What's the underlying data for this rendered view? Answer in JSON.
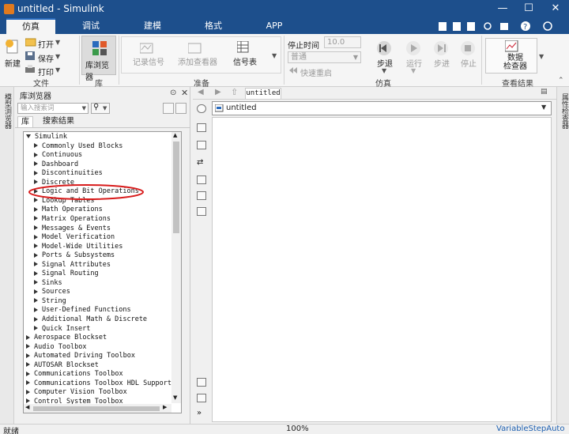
{
  "window": {
    "title": "untitled - Simulink",
    "minimize_label": "—",
    "maximize_label": "☐",
    "close_label": "✕"
  },
  "ribbon_tabs": [
    {
      "label": "仿真",
      "active": true
    },
    {
      "label": "调试",
      "active": false
    },
    {
      "label": "建模",
      "active": false
    },
    {
      "label": "格式",
      "active": false
    },
    {
      "label": "APP",
      "active": false
    }
  ],
  "ribbon": {
    "file": {
      "new_label": "新建",
      "open_label": "打开",
      "save_label": "保存",
      "print_label": "打印",
      "group_label": "文件"
    },
    "library": {
      "browser_label": "库浏览器",
      "group_label": "库"
    },
    "prepare": {
      "log_signals_label": "记录信号",
      "add_viewer_label": "添加查看器",
      "signal_table_label": "信号表",
      "group_label": "准备"
    },
    "simulate": {
      "stop_time_label": "停止时间",
      "stop_time_value": "10.0",
      "mode_value": "普通",
      "fast_restart_label": "快速重启",
      "step_back_label": "步退",
      "run_label": "运行",
      "step_forward_label": "步进",
      "stop_label": "停止",
      "group_label": "仿真"
    },
    "review": {
      "data_inspector_label": "数据\n检查器",
      "group_label": "查看结果"
    }
  },
  "left_strip": {
    "model_browser_label": "模型浏览器"
  },
  "right_strip": {
    "property_inspector_label": "属性检查器"
  },
  "library_browser": {
    "title": "库浏览器",
    "search_placeholder": "输入搜索词",
    "tabs": [
      "库",
      "搜索结果"
    ],
    "tree": [
      {
        "label": "Simulink",
        "expanded": true,
        "level": 0
      },
      {
        "label": "Commonly Used Blocks",
        "level": 1
      },
      {
        "label": "Continuous",
        "level": 1
      },
      {
        "label": "Dashboard",
        "level": 1
      },
      {
        "label": "Discontinuities",
        "level": 1
      },
      {
        "label": "Discrete",
        "level": 1
      },
      {
        "label": "Logic and Bit Operations",
        "level": 1,
        "highlighted": true
      },
      {
        "label": "Lookup Tables",
        "level": 1
      },
      {
        "label": "Math Operations",
        "level": 1
      },
      {
        "label": "Matrix Operations",
        "level": 1
      },
      {
        "label": "Messages & Events",
        "level": 1
      },
      {
        "label": "Model Verification",
        "level": 1
      },
      {
        "label": "Model-Wide Utilities",
        "level": 1
      },
      {
        "label": "Ports & Subsystems",
        "level": 1
      },
      {
        "label": "Signal Attributes",
        "level": 1
      },
      {
        "label": "Signal Routing",
        "level": 1
      },
      {
        "label": "Sinks",
        "level": 1
      },
      {
        "label": "Sources",
        "level": 1
      },
      {
        "label": "String",
        "level": 1
      },
      {
        "label": "User-Defined Functions",
        "level": 1
      },
      {
        "label": "Additional Math & Discrete",
        "level": 1
      },
      {
        "label": "Quick Insert",
        "level": 1
      },
      {
        "label": "Aerospace Blockset",
        "level": 0
      },
      {
        "label": "Audio Toolbox",
        "level": 0
      },
      {
        "label": "Automated Driving Toolbox",
        "level": 0
      },
      {
        "label": "AUTOSAR Blockset",
        "level": 0
      },
      {
        "label": "Communications Toolbox",
        "level": 0
      },
      {
        "label": "Communications Toolbox HDL Support",
        "level": 0
      },
      {
        "label": "Computer Vision Toolbox",
        "level": 0
      },
      {
        "label": "Control System Toolbox",
        "level": 0
      }
    ]
  },
  "canvas": {
    "tab_label": "untitled",
    "address": "untitled"
  },
  "status": {
    "left": "就绪",
    "zoom": "100%",
    "solver": "VariableStepAuto"
  },
  "colors": {
    "titlebar": "#1d4f8c",
    "highlight_circle": "#d81b1b"
  }
}
